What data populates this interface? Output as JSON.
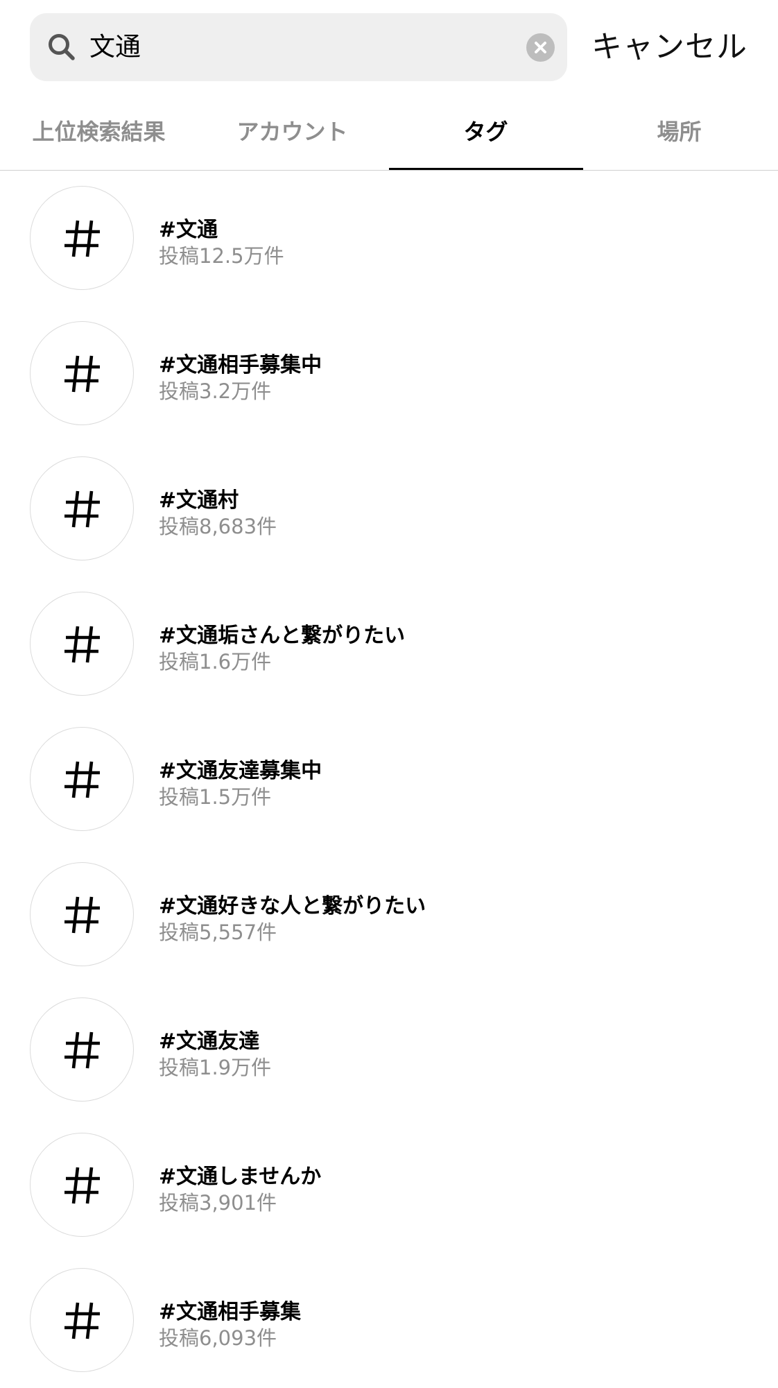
{
  "search": {
    "query": "文通",
    "cancel_label": "キャンセル"
  },
  "tabs": [
    {
      "label": "上位検索結果",
      "active": false
    },
    {
      "label": "アカウント",
      "active": false
    },
    {
      "label": "タグ",
      "active": true
    },
    {
      "label": "場所",
      "active": false
    }
  ],
  "hashtags": [
    {
      "icon": "hashtag-icon",
      "name": "#文通",
      "count": "投稿12.5万件"
    },
    {
      "icon": "hashtag-icon",
      "name": "#文通相手募集中",
      "count": "投稿3.2万件"
    },
    {
      "icon": "hashtag-icon",
      "name": "#文通村",
      "count": "投稿8,683件"
    },
    {
      "icon": "hashtag-icon",
      "name": "#文通垢さんと繋がりたい",
      "count": "投稿1.6万件"
    },
    {
      "icon": "hashtag-icon",
      "name": "#文通友達募集中",
      "count": "投稿1.5万件"
    },
    {
      "icon": "hashtag-icon",
      "name": "#文通好きな人と繋がりたい",
      "count": "投稿5,557件"
    },
    {
      "icon": "hashtag-icon",
      "name": "#文通友達",
      "count": "投稿1.9万件"
    },
    {
      "icon": "hashtag-icon",
      "name": "#文通しませんか",
      "count": "投稿3,901件"
    },
    {
      "icon": "hashtag-icon",
      "name": "#文通相手募集",
      "count": "投稿6,093件"
    }
  ],
  "colors": {
    "search_background": "#efefef",
    "secondary_text": "#8e8e8e",
    "active_indicator": "#000000"
  }
}
